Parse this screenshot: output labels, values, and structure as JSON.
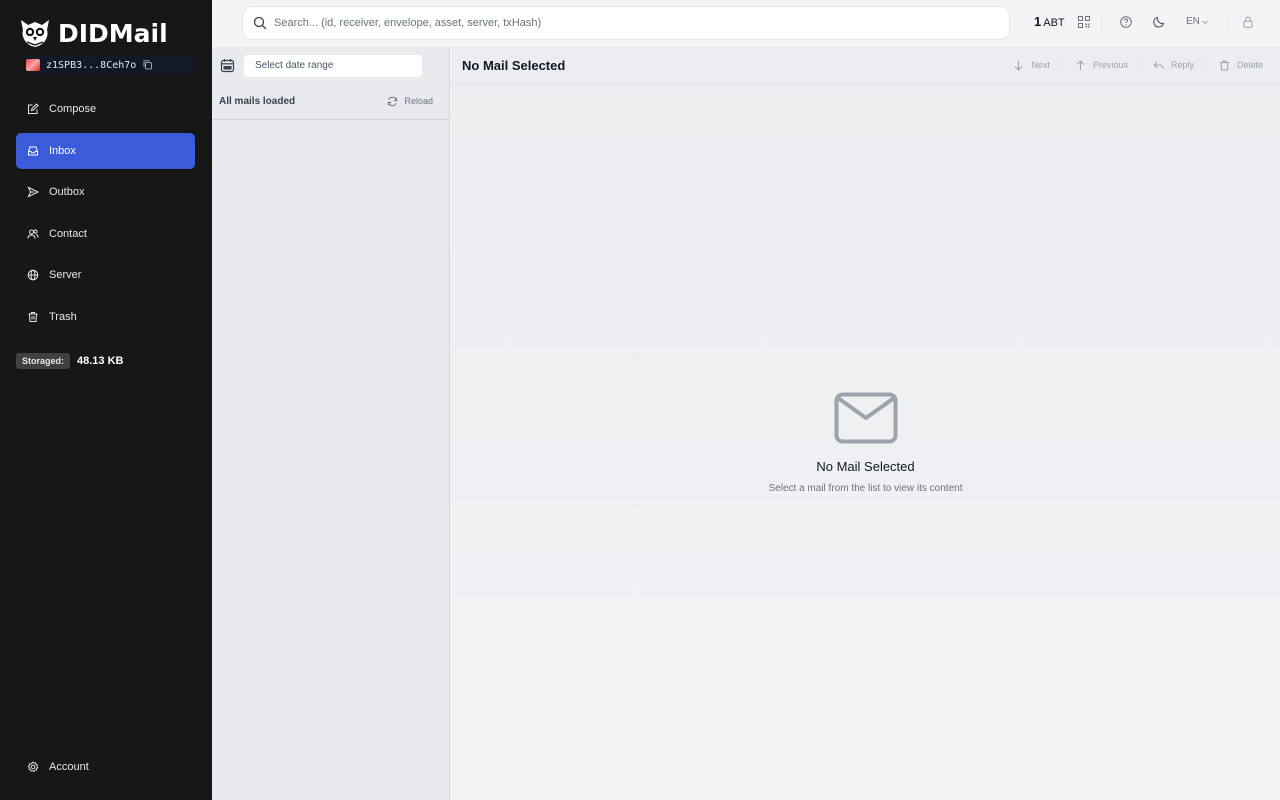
{
  "app": {
    "brand": "DIDMail",
    "did_short": "z1SPB3...8Ceh7o"
  },
  "sidebar": {
    "items": [
      {
        "label": "Compose",
        "icon": "pencil-square-icon"
      },
      {
        "label": "Inbox",
        "icon": "inbox-icon",
        "active": true
      },
      {
        "label": "Outbox",
        "icon": "send-icon"
      },
      {
        "label": "Contact",
        "icon": "users-icon"
      },
      {
        "label": "Server",
        "icon": "globe-icon"
      },
      {
        "label": "Trash",
        "icon": "trash-icon"
      }
    ],
    "storage_label": "Storaged:",
    "storage_value": "48.13 KB",
    "account_label": "Account"
  },
  "topbar": {
    "search_placeholder": "Search... (id, receiver, envelope, asset, server, txHash)",
    "balance_amount": "1",
    "balance_unit": "ABT",
    "language": "EN"
  },
  "list": {
    "date_placeholder": "Select date range",
    "status": "All mails loaded",
    "reload_label": "Reload"
  },
  "main": {
    "title": "No Mail Selected",
    "actions": {
      "next": "Next",
      "previous": "Previous",
      "reply": "Reply",
      "delete": "Delete"
    },
    "empty_title": "No Mail Selected",
    "empty_subtitle": "Select a mail from the list to view its content"
  },
  "colors": {
    "sidebar_bg": "#171717",
    "accent": "#3b5bdb",
    "page_bg": "#f3f4f6"
  }
}
